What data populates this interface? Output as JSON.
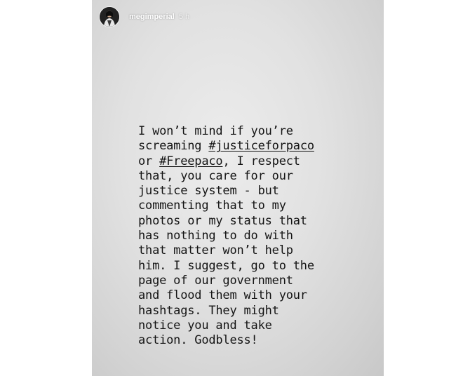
{
  "story": {
    "username": "megimperial",
    "timestamp": "5 h",
    "avatar_icon": "profile-photo-icon"
  },
  "caption": {
    "lines": [
      [
        {
          "text": "I won’t mind if you’re"
        }
      ],
      [
        {
          "text": "screaming "
        },
        {
          "text": "#justiceforpaco",
          "tag": true
        }
      ],
      [
        {
          "text": "or "
        },
        {
          "text": "#Freepaco",
          "tag": true
        },
        {
          "text": ", I respect"
        }
      ],
      [
        {
          "text": "that, you care for our"
        }
      ],
      [
        {
          "text": "justice system - but"
        }
      ],
      [
        {
          "text": "commenting that to my"
        }
      ],
      [
        {
          "text": "photos or my status that"
        }
      ],
      [
        {
          "text": "has nothing to do with"
        }
      ],
      [
        {
          "text": "that matter won’t help"
        }
      ],
      [
        {
          "text": "him. I suggest, go to the"
        }
      ],
      [
        {
          "text": "page of our government"
        }
      ],
      [
        {
          "text": "and flood them with your"
        }
      ],
      [
        {
          "text": "hashtags. They might"
        }
      ],
      [
        {
          "text": "notice you and take"
        }
      ],
      [
        {
          "text": "action. Godbless!"
        }
      ]
    ]
  }
}
